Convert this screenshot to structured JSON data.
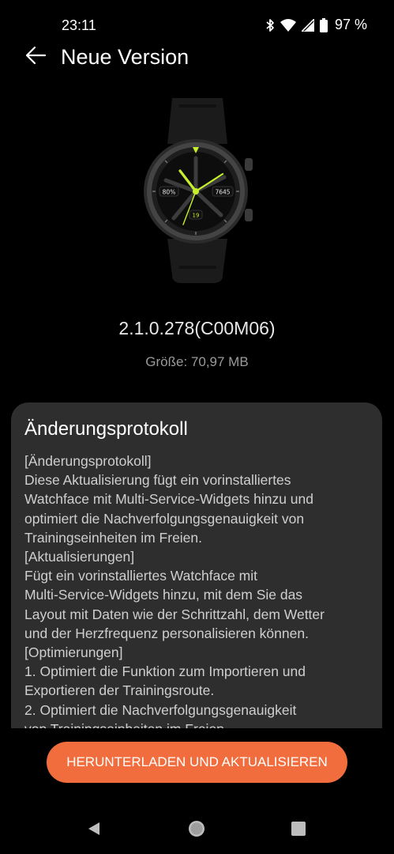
{
  "status_bar": {
    "time": "23:11",
    "battery": "97 %",
    "icons": [
      "bluetooth-icon",
      "wifi-icon",
      "signal-icon",
      "battery-icon"
    ]
  },
  "header": {
    "title": "Neue Version",
    "back_icon": "arrow-left-icon"
  },
  "watch": {
    "battery_widget": "80%",
    "steps_widget": "7645",
    "date_widget": "19",
    "accent": "#c6f02c"
  },
  "update": {
    "version": "2.1.0.278(C00M06)",
    "size": "Größe: 70,97 MB"
  },
  "changelog": {
    "title": "Änderungsprotokoll",
    "lines": [
      "[Änderungsprotokoll]",
      "Diese Aktualisierung fügt ein vorinstalliertes",
      "Watchface mit Multi-Service-Widgets hinzu und",
      "optimiert die Nachverfolgungsgenauigkeit von",
      "Trainingseinheiten im Freien.",
      "[Aktualisierungen]",
      "Fügt ein vorinstalliertes Watchface mit",
      "Multi-Service-Widgets hinzu, mit dem Sie das",
      "Layout mit Daten wie der Schrittzahl, dem Wetter",
      "und der Herzfrequenz personalisieren können.",
      "[Optimierungen]",
      "1. Optimiert die Funktion zum Importieren und",
      "Exportieren der Trainingsroute.",
      "2. Optimiert die Nachverfolgungsgenauigkeit",
      "von Trainingseinheiten im Freien."
    ]
  },
  "action": {
    "label": "HERUNTERLADEN UND AKTUALISIEREN",
    "color": "#f26d3d"
  },
  "nav": {
    "back": "triangle-back-icon",
    "home": "circle-home-icon",
    "recents": "square-recents-icon"
  }
}
